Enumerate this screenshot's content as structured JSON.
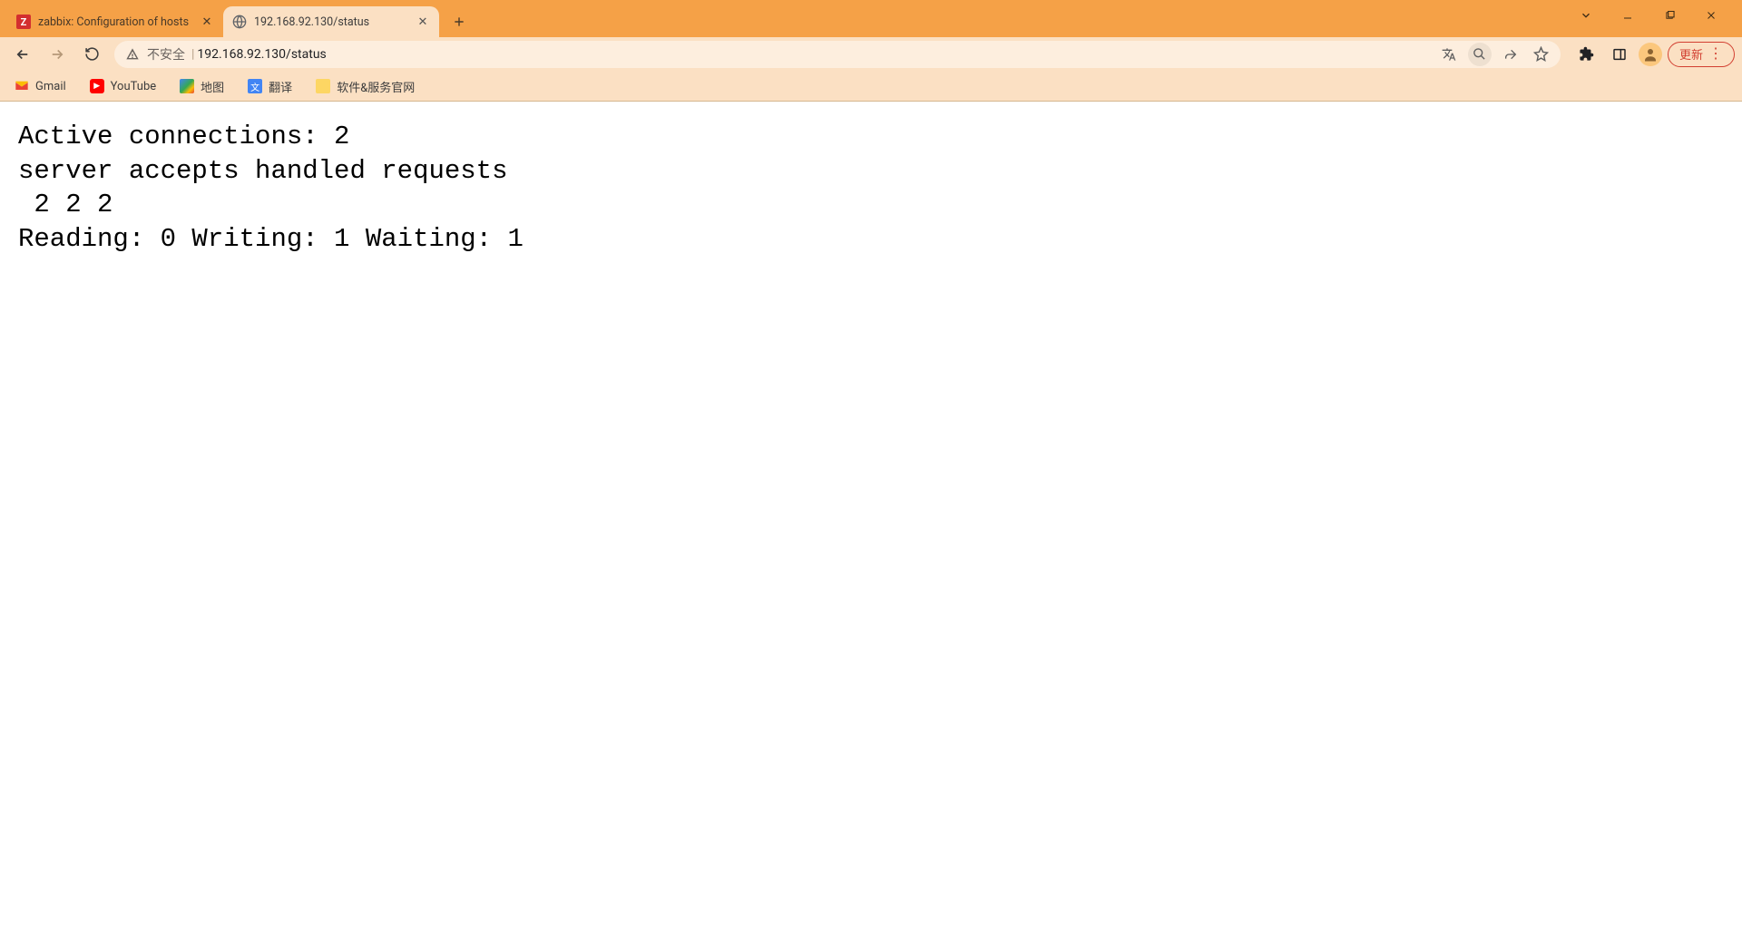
{
  "tabs": [
    {
      "title": "zabbix: Configuration of hosts",
      "favicon": "zabbix"
    },
    {
      "title": "192.168.92.130/status",
      "favicon": "globe"
    }
  ],
  "window": {
    "search_tabs_tip": "v",
    "min": "—",
    "max": "▢",
    "close": "✕"
  },
  "nav": {
    "back": "←",
    "forward": "→",
    "reload": "↻"
  },
  "omnibox": {
    "security_label": "不安全",
    "url": "192.168.92.130/status",
    "translate_tip": "Translate",
    "zoom_tip": "Zoom",
    "share_tip": "Share",
    "star_tip": "Bookmark"
  },
  "toolbar_right": {
    "extensions_tip": "Extensions",
    "sidepanel_tip": "Side panel",
    "avatar_tip": "Profile",
    "update_label": "更新"
  },
  "bookmarks": [
    {
      "label": "Gmail",
      "icon": "gmail"
    },
    {
      "label": "YouTube",
      "icon": "youtube"
    },
    {
      "label": "地图",
      "icon": "maps"
    },
    {
      "label": "翻译",
      "icon": "translate"
    },
    {
      "label": "软件&服务官网",
      "icon": "folder"
    }
  ],
  "content": {
    "line1": "Active connections: 2 ",
    "line2": "server accepts handled requests",
    "line3": " 2 2 2 ",
    "line4": "Reading: 0 Writing: 1 Waiting: 1 "
  }
}
